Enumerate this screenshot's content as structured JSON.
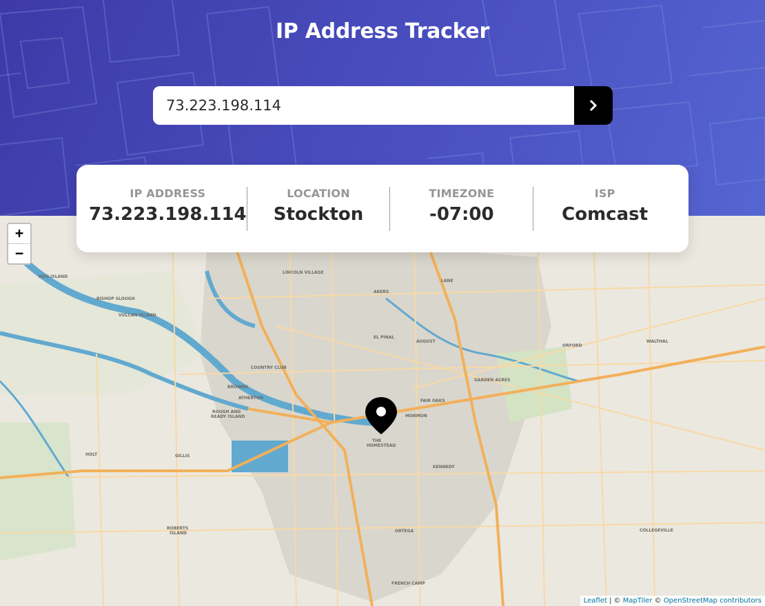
{
  "header": {
    "title": "IP Address Tracker",
    "search_value": "73.223.198.114",
    "submit_icon": "chevron-right-icon"
  },
  "info": {
    "ip": {
      "label": "IP ADDRESS",
      "value": "73.223.198.114"
    },
    "location": {
      "label": "LOCATION",
      "value": "Stockton"
    },
    "timezone": {
      "label": "TIMEZONE",
      "value": "-07:00"
    },
    "isp": {
      "label": "ISP",
      "value": "Comcast"
    }
  },
  "map": {
    "zoom_in": "+",
    "zoom_out": "−",
    "attribution": {
      "leaflet": "Leaflet",
      "separator": " | © ",
      "maptiler": "MapTiler",
      "copy": " © ",
      "osm": "OpenStreetMap contributors"
    },
    "place_labels": [
      "LINCOLN VILLAGE",
      "AKERS",
      "LANE",
      "EL PINAL",
      "AUGUST",
      "ORFORD",
      "WALTHAL",
      "COUNTRY CLUB",
      "GARDEN ACRES",
      "BROWNS",
      "ATHERTON",
      "FAIR OAKS",
      "MORMON",
      "ROUGH AND",
      "READY ISLAND",
      "THE",
      "HOMESTEAD",
      "KENNEDY",
      "GILLIS",
      "HOLT",
      "ROBERTS",
      "ISLAND",
      "ORTEGA",
      "COLLEGEVILLE",
      "FRENCH CAMP",
      "VULCAN ISLAND",
      "HOG ISLAND",
      "BISHOP SLOUGH"
    ],
    "colors": {
      "water": "#62a9cf",
      "major_road": "#f2b05a",
      "minor_road": "#fbd9a3",
      "urban": "#d8d5cc",
      "park": "#cfe0c1"
    }
  },
  "theme": {
    "hero_from": "#3d3aa7",
    "hero_to": "#5565d1",
    "button": "#000000"
  }
}
